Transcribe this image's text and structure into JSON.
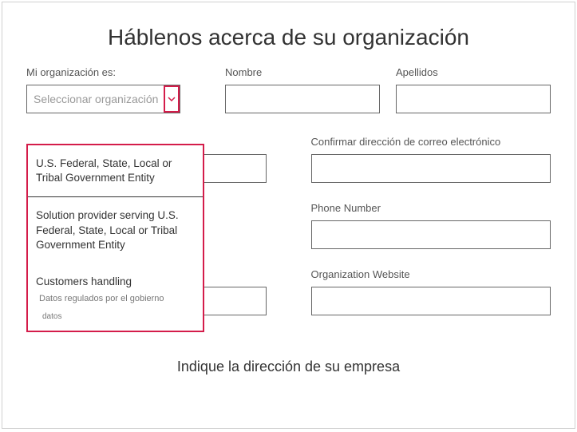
{
  "page": {
    "title": "Háblenos acerca de su organización",
    "subtitle": "Indique la dirección de su empresa"
  },
  "org_select": {
    "label": "Mi organización es:",
    "placeholder": "Seleccionar organización",
    "options": {
      "opt1": "U.S. Federal, State, Local or Tribal Government Entity",
      "opt2": "Solution provider serving U.S. Federal, State, Local or Tribal Government Entity",
      "opt3": "Customers handling",
      "opt3_sub": "Datos regulados por el gobierno",
      "opt3_sub2": "datos"
    }
  },
  "fields": {
    "first_name": "Nombre",
    "last_name": "Apellidos",
    "confirm_email": "Confirmar dirección de correo electrónico",
    "phone": "Phone Number",
    "org_website": "Organization Website"
  }
}
